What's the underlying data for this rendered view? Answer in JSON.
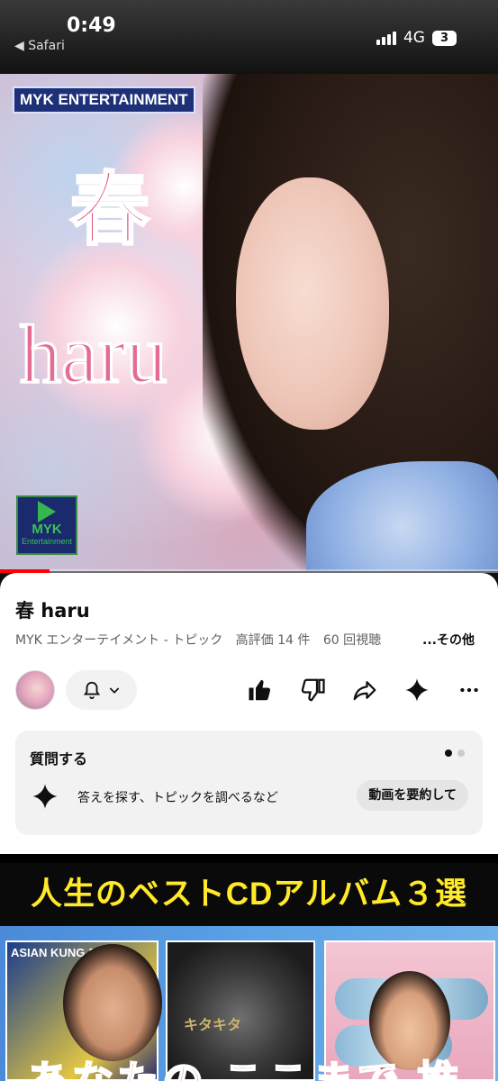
{
  "status": {
    "time": "0:49",
    "back_label": "◀ Safari",
    "network": "4G",
    "battery": "3"
  },
  "video": {
    "brand_banner": "MYK ENTERTAINMENT",
    "title_kanji": "春",
    "title_latin": "haru",
    "logo_text_1": "MYK",
    "logo_text_2": "Entertainment",
    "progress_fraction": 0.1
  },
  "details": {
    "title": "春 haru",
    "channel": "MYK エンターテイメント - トピック",
    "likes": "高評価 14 件",
    "views": "60 回視聴",
    "more_label": "...その他"
  },
  "icons": {
    "bell": "bell-icon",
    "like": "thumbs-up-icon",
    "dislike": "thumbs-down-icon",
    "share": "share-icon",
    "ask": "sparkle-icon",
    "menu": "more-horizontal-icon"
  },
  "ask": {
    "title": "質問する",
    "hint": "答えを探す、トピックを調べるなど",
    "summarize_label": "動画を要約して"
  },
  "next_video": {
    "headline": "人生のベストCDアルバム３選",
    "album1_label": "ASIAN KUNG-F",
    "album2_label": "キタキタ",
    "bottom_text": "あなたの ここまで 推化"
  },
  "colors": {
    "brand_red": "#ff0000",
    "headline_yellow": "#ffe928",
    "title_pink": "#e0587f"
  }
}
